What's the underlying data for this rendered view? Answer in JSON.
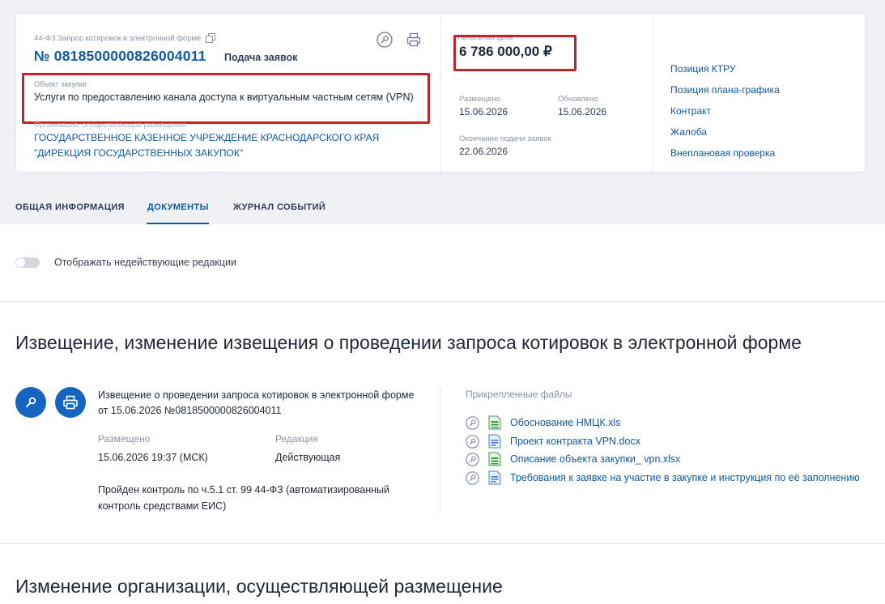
{
  "header": {
    "law_label": "44-ФЗ Запрос котировок в электронной форме",
    "reg_number": "№ 0818500000826004011",
    "stage": "Подача заявок",
    "object_label": "Объект закупки",
    "object_text": "Услуги по предоставлению канала доступа к виртуальным частным сетям (VPN)",
    "customer_label": "Организация, осуществляющая размещение",
    "customer_name": "ГОСУДАРСТВЕННОЕ КАЗЕННОЕ УЧРЕЖДЕНИЕ КРАСНОДАРСКОГО КРАЯ \"ДИРЕКЦИЯ ГОСУДАРСТВЕННЫХ ЗАКУПОК\""
  },
  "price_block": {
    "price_label": "Начальная цена",
    "price": "6 786 000,00 ₽",
    "posted_label": "Размещено",
    "posted_value": "15.06.2026",
    "updated_label": "Обновлено",
    "updated_value": "15.06.2026",
    "deadline_label": "Окончание подачи заявок",
    "deadline_value": "22.06.2026"
  },
  "side_links": [
    "Позиция КТРУ",
    "Позиция плана-графика",
    "Контракт",
    "Жалоба",
    "Внеплановая проверка"
  ],
  "tabs": [
    "ОБЩАЯ ИНФОРМАЦИЯ",
    "ДОКУМЕНТЫ",
    "ЖУРНАЛ СОБЫТИЙ"
  ],
  "active_tab": "ДОКУМЕНТЫ",
  "toggle": {
    "label": "Отображать недействующие редакции",
    "on": false
  },
  "section1": {
    "title": "Извещение, изменение извещения о проведении запроса котировок в электронной форме",
    "doc_title": "Извещение о проведении запроса котировок в электронной форме от 15.06.2026 №0818500000826004011",
    "posted_label": "Размещено",
    "posted_value": "15.06.2026 19:37 (МСК)",
    "edition_label": "Редакция",
    "edition_value": "Действующая",
    "control_text": "Пройден контроль по ч.5.1 ст. 99 44-ФЗ (автоматизированный контроль средствами ЕИС)",
    "files_label": "Прикрепленные файлы",
    "files": [
      {
        "name": "Обоснование НМЦК.xls",
        "type": "xls"
      },
      {
        "name": "Проект контракта VPN.docx",
        "type": "docx"
      },
      {
        "name": "Описание объекта закупки_ vpn.xlsx",
        "type": "xlsx"
      },
      {
        "name": "Требования к заявке на участие в закупке и инструкция по её заполнению",
        "type": "docx"
      }
    ]
  },
  "section2": {
    "title": "Изменение организации, осуществляющей размещение"
  },
  "colors": {
    "link": "#0d5aa7",
    "accent": "#1565c0",
    "highlight": "#c8202a",
    "xls_green": "#3a9a3e",
    "doc_blue": "#4a7fc1"
  },
  "icons": [
    "copy-icon",
    "key-icon",
    "printer-icon",
    "file-xls-icon",
    "file-docx-icon"
  ]
}
